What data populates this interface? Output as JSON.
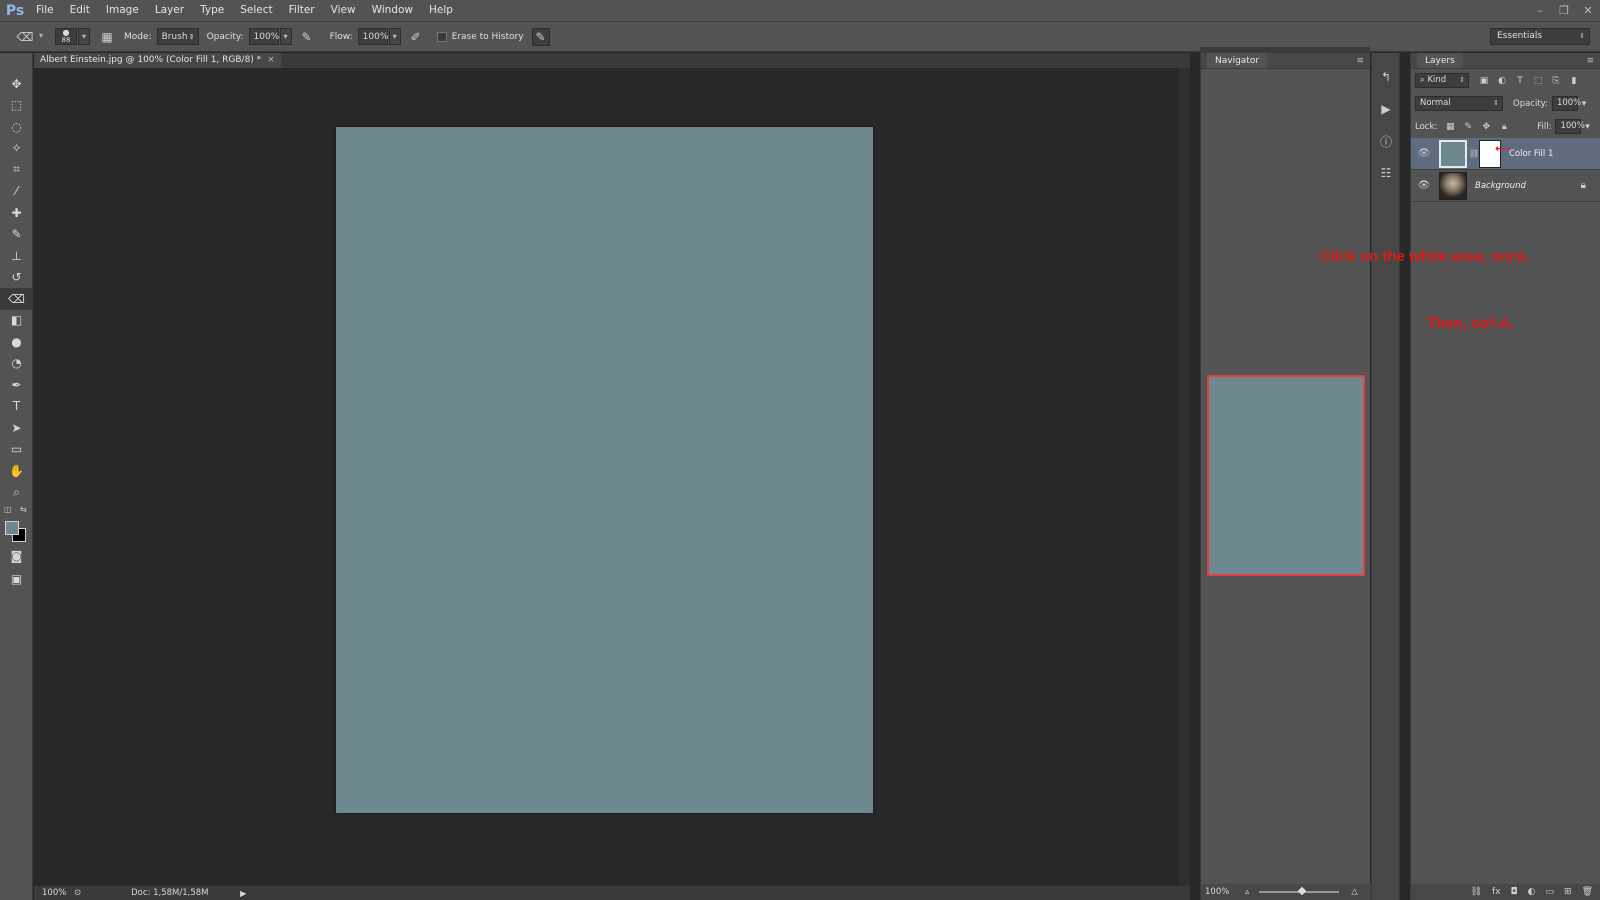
{
  "app": {
    "logo": "Ps"
  },
  "menu": [
    "File",
    "Edit",
    "Image",
    "Layer",
    "Type",
    "Select",
    "Filter",
    "View",
    "Window",
    "Help"
  ],
  "options": {
    "brush_size": "88",
    "mode_label": "Mode:",
    "mode_value": "Brush",
    "opacity_label": "Opacity:",
    "opacity_value": "100%",
    "flow_label": "Flow:",
    "flow_value": "100%",
    "erase_history_label": "Erase to History",
    "workspace": "Essentials"
  },
  "document": {
    "tab_title": "Albert Einstein.jpg @ 100% (Color Fill 1, RGB/8) *",
    "canvas_color": "#6e8890"
  },
  "status": {
    "zoom": "100%",
    "doc_info": "Doc: 1,58M/1,58M"
  },
  "navigator": {
    "title": "Navigator",
    "zoom": "100%"
  },
  "layers": {
    "title": "Layers",
    "filter_kind": "Kind",
    "blend_mode": "Normal",
    "opacity_label": "Opacity:",
    "opacity_value": "100%",
    "lock_label": "Lock:",
    "fill_label": "Fill:",
    "fill_value": "100%",
    "items": [
      {
        "name": "Color Fill 1",
        "selected": true
      },
      {
        "name": "Background",
        "selected": false
      }
    ]
  },
  "annotations": {
    "line1": "Click on the white area, once.",
    "line2": "Then, ctrl-A."
  },
  "colors": {
    "accent_red": "#e01818",
    "fill_color": "#6e8890"
  }
}
